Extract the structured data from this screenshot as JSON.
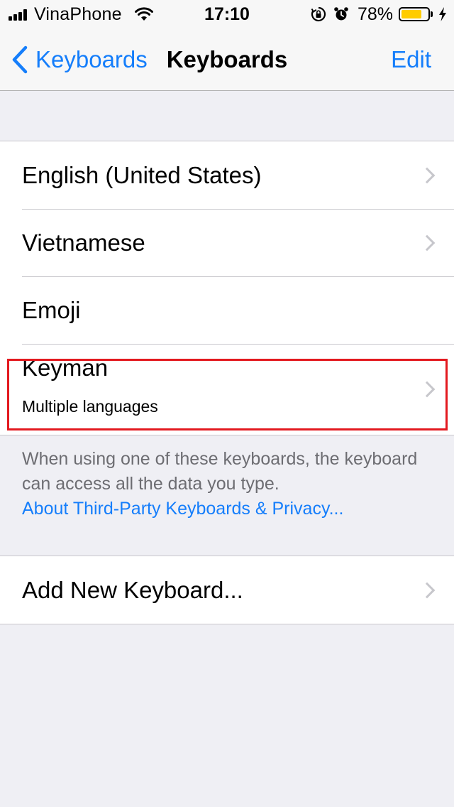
{
  "status_bar": {
    "carrier": "VinaPhone",
    "time": "17:10",
    "battery_percent": "78%",
    "battery_level": 0.78,
    "battery_color": "#ffcc00",
    "icons": [
      "signal-icon",
      "wifi-icon",
      "orientation-lock-icon",
      "alarm-icon",
      "battery-icon",
      "charging-icon"
    ]
  },
  "nav": {
    "back_label": "Keyboards",
    "title": "Keyboards",
    "edit_label": "Edit",
    "accent_color": "#157efb"
  },
  "keyboards": [
    {
      "label": "English (United States)",
      "has_chevron": true
    },
    {
      "label": "Vietnamese",
      "has_chevron": true
    },
    {
      "label": "Emoji",
      "has_chevron": false
    },
    {
      "label": "Keyman",
      "subtitle": "Multiple languages",
      "has_chevron": true,
      "highlighted": true
    }
  ],
  "footer": {
    "note": "When using one of these keyboards, the keyboard can access all the data you type.",
    "link": "About Third-Party Keyboards & Privacy..."
  },
  "add_keyboard": {
    "label": "Add New Keyboard..."
  },
  "highlight_color": "#e3191f"
}
